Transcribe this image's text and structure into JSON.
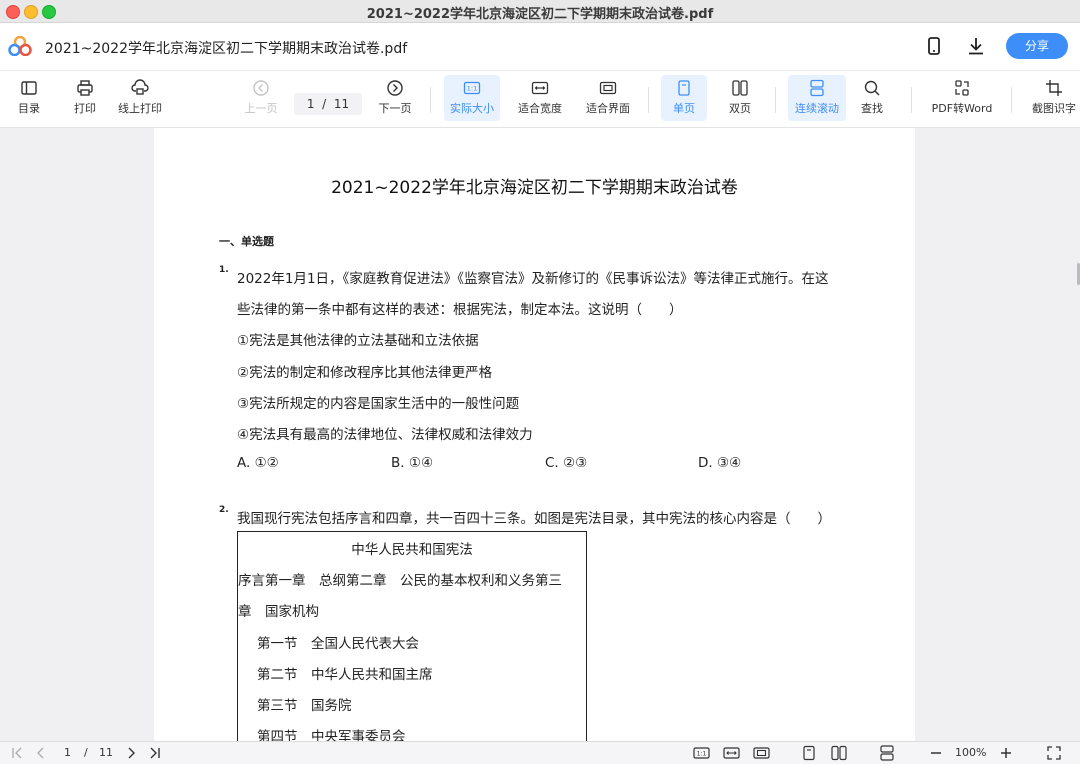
{
  "window": {
    "title": "2021~2022学年北京海淀区初二下学期期末政治试卷.pdf"
  },
  "header": {
    "doc_title": "2021~2022学年北京海淀区初二下学期期末政治试卷.pdf",
    "share_label": "分享",
    "icons": [
      "phone-icon",
      "download-icon"
    ]
  },
  "toolbar": {
    "toc": "目录",
    "print": "打印",
    "online_print": "线上打印",
    "prev": "上一页",
    "page_current": "1",
    "page_sep": "/",
    "page_total": "11",
    "next": "下一页",
    "actual_size": "实际大小",
    "fit_width": "适合宽度",
    "fit_page": "适合界面",
    "single_page": "单页",
    "double_page": "双页",
    "continuous": "连续滚动",
    "find": "查找",
    "pdf_to_word": "PDF转Word",
    "screenshot_ocr": "截图识字"
  },
  "document": {
    "title": "2021~2022学年北京海淀区初二下学期期末政治试卷",
    "section": "一、单选题",
    "q1": {
      "num": "1.",
      "lines": [
        "2022年1月1日，《家庭教育促进法》《监察官法》及新修订的《民事诉讼法》等法律正式施行。在这",
        "些法律的第一条中都有这样的表述：根据宪法，制定本法。这说明（　　）",
        "①宪法是其他法律的立法基础和立法依据",
        "②宪法的制定和修改程序比其他法律更严格",
        "③宪法所规定的内容是国家生活中的一般性问题",
        "④宪法具有最高的法律地位、法律权威和法律效力"
      ],
      "options": [
        "A. ①②",
        "B. ①④",
        "C. ②③",
        "D. ③④"
      ]
    },
    "q2": {
      "num": "2.",
      "stem": "我国现行宪法包括序言和四章，共一百四十三条。如图是宪法目录，其中宪法的核心内容是（　　）",
      "table": [
        "中华人民共和国宪法",
        "序言第一章　总纲第二章　公民的基本权利和义务第三",
        "章　国家机构",
        "第一节　全国人民代表大会",
        "第二节　中华人民共和国主席",
        "第三节　国务院",
        "第四节　中央军事委员会"
      ]
    }
  },
  "bottombar": {
    "page_current": "1",
    "page_sep": "/",
    "page_total": "11",
    "zoom": "100%"
  },
  "colors": {
    "accent": "#3d8ef8",
    "active_bg": "#e8f1fe"
  }
}
